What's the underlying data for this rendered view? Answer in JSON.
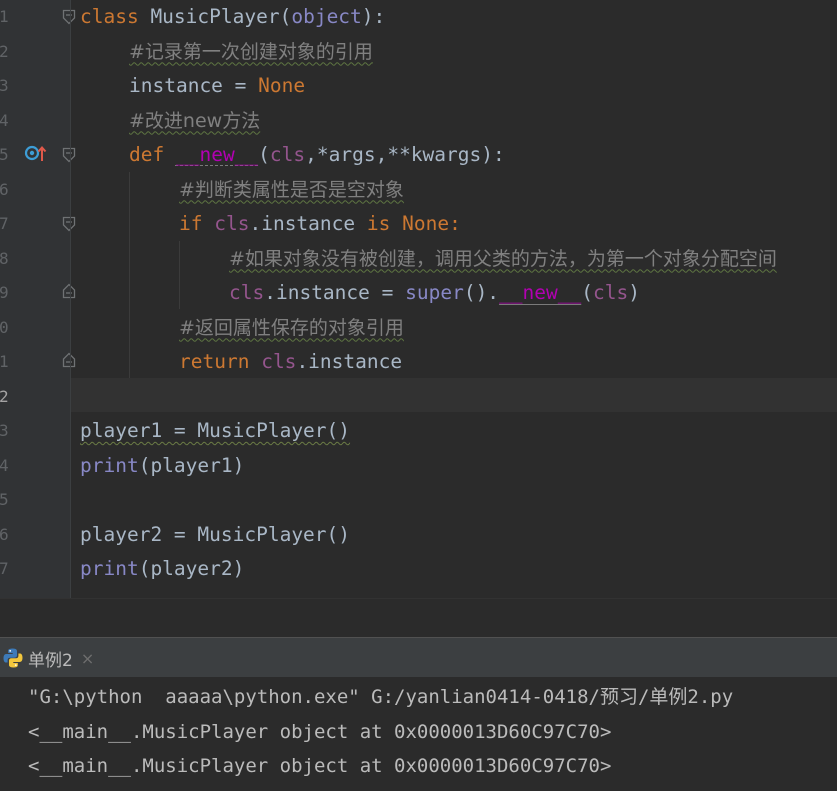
{
  "editor": {
    "line_numbers": [
      "1",
      "2",
      "3",
      "4",
      "5",
      "6",
      "7",
      "8",
      "9",
      "0",
      "1",
      "2",
      "3",
      "4",
      "5",
      "6",
      "7"
    ],
    "lines": {
      "l1": {
        "kw": "class",
        "name": " MusicPlayer",
        "open": "(",
        "base": "object",
        "close": "):"
      },
      "l2": {
        "comment": "#记录第一次创建对象的引用"
      },
      "l3": {
        "name": "instance",
        "op": " = ",
        "value": "None"
      },
      "l4": {
        "comment": "#改进new方法"
      },
      "l5": {
        "kw": "def",
        "sp": " ",
        "func": "__new__",
        "open": "(",
        "self": "cls",
        "args": ",*args,**kwargs",
        "close": "):"
      },
      "l6": {
        "comment": "#判断类属性是否是空对象"
      },
      "l7": {
        "kw": "if",
        "sp": " ",
        "self": "cls",
        "attr": ".instance ",
        "kw2": "is",
        "sp2": " ",
        "value": "None",
        "colon": ":"
      },
      "l8": {
        "comment": "#如果对象没有被创建，调用父类的方法，为第一个对象分配空间"
      },
      "l9": {
        "self": "cls",
        "attr": ".instance = ",
        "builtin": "super",
        "mid": "().",
        "func": "__new__",
        "open": "(",
        "self2": "cls",
        "close": ")"
      },
      "l10": {
        "comment": "#返回属性保存的对象引用"
      },
      "l11": {
        "kw": "return",
        "sp": " ",
        "self": "cls",
        "attr": ".instance"
      },
      "l13": {
        "text": "player1 = MusicPlayer()"
      },
      "l14": {
        "builtin": "print",
        "args": "(player1)"
      },
      "l16": {
        "text": "player2 = MusicPlayer()"
      },
      "l17": {
        "builtin": "print",
        "args": "(player2)"
      }
    }
  },
  "run_panel": {
    "tab_label": "单例2",
    "tab_close": "×",
    "console_lines": [
      "\"G:\\python  aaaaa\\python.exe\" G:/yanlian0414-0418/预习/单例2.py",
      "<__main__.MusicPlayer object at 0x0000013D60C97C70>",
      "<__main__.MusicPlayer object at 0x0000013D60C97C70>"
    ]
  },
  "colors": {
    "background": "#2b2b2b",
    "keyword": "#cc7832",
    "self": "#94558d",
    "builtin": "#8888c6",
    "magic": "#b200b2",
    "comment": "#808080",
    "text": "#a9b7c6"
  },
  "icons": {
    "gutter_override": "override-method-icon",
    "fold": "fold-marker-icon",
    "run_tab": "python-icon"
  }
}
